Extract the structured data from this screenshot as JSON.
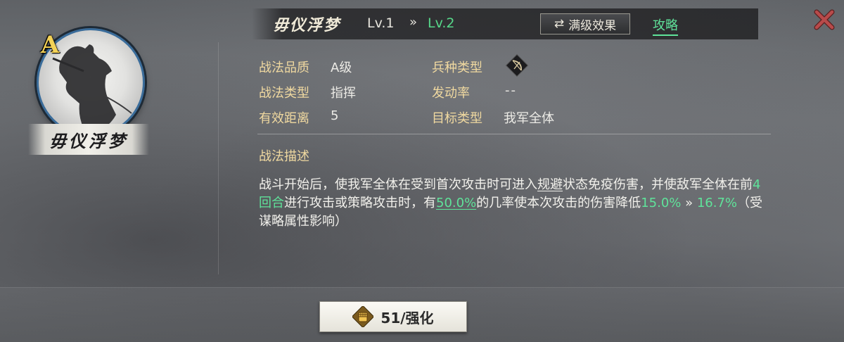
{
  "skill": {
    "name": "毋仪浮梦",
    "grade_badge": "A",
    "level_current": "Lv.1",
    "level_sep": "»",
    "level_next": "Lv.2"
  },
  "header": {
    "max_effect_label": "满级效果",
    "strategy_link": "攻略",
    "swap_icon": "⇄"
  },
  "info": {
    "quality_label": "战法品质",
    "quality_value": "A级",
    "type_label": "战法类型",
    "type_value": "指挥",
    "range_label": "有效距离",
    "range_value": "5",
    "troop_label": "兵种类型",
    "troop_icon": "bow-icon",
    "rate_label": "发动率",
    "rate_value": "--",
    "target_label": "目标类型",
    "target_value": "我军全体"
  },
  "description": {
    "title": "战法描述",
    "p1": "战斗开始后，使我军全体在受到首次攻击时可进入",
    "p2_ul": "规避",
    "p3": "状态免疫伤害，并使敌军全体在前",
    "p4_hl": "4回合",
    "p5": "进行攻击或策略攻击时，有",
    "p6_hl": "50.0%",
    "p7": "的几率使本次攻击的伤害降低",
    "p8_hl": "15.0%",
    "p9": " » ",
    "p10_hl": "16.7%",
    "p11": "（受谋略属性影响）"
  },
  "upgrade": {
    "label": "51/强化",
    "icon": "fist-icon"
  },
  "colors": {
    "accent_green": "#5fe39a",
    "label_gold": "#f0d9a0",
    "close_red": "#b84b4b",
    "grade_yellow": "#f4d257"
  }
}
